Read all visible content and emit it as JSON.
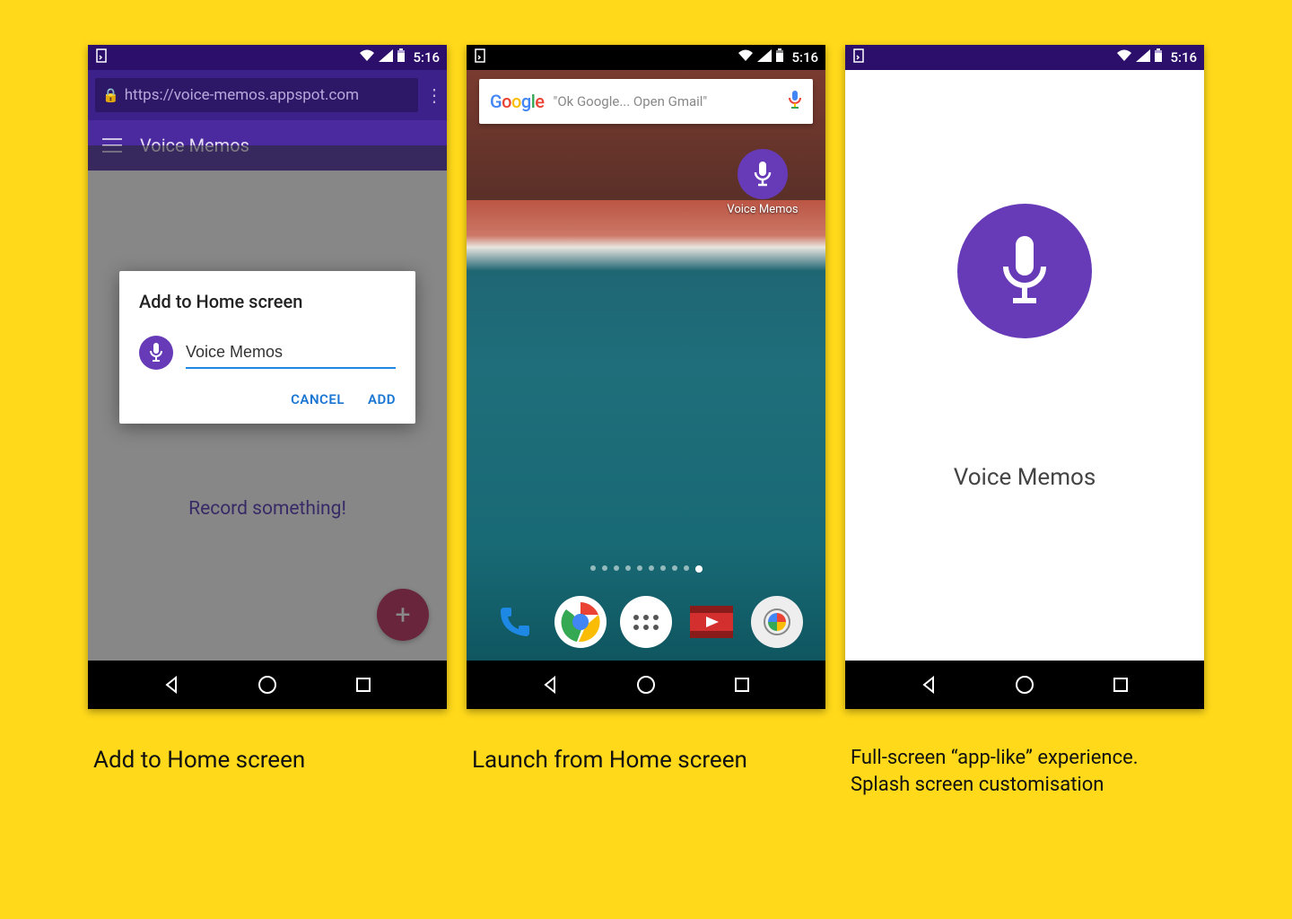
{
  "status": {
    "time": "5:16"
  },
  "phone1": {
    "url": "https://voice-memos.appspot.com",
    "app_title": "Voice Memos",
    "prompt_text": "Record something!",
    "dialog": {
      "title": "Add to Home screen",
      "input_value": "Voice Memos",
      "cancel": "CANCEL",
      "add": "ADD"
    }
  },
  "phone2": {
    "search_placeholder": "\"Ok Google... Open Gmail\"",
    "home_icon_label": "Voice Memos"
  },
  "phone3": {
    "splash_title": "Voice Memos"
  },
  "captions": {
    "c1": "Add to Home screen",
    "c2": "Launch from Home screen",
    "c3": "Full-screen “app-like” experience. Splash screen customisation"
  },
  "colors": {
    "accent": "#673ab7"
  }
}
